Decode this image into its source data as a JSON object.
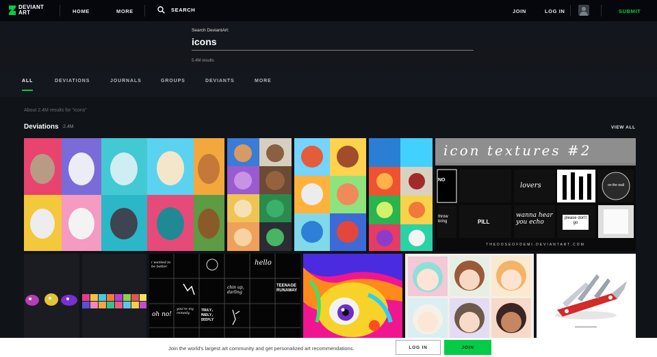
{
  "nav": {
    "logo_line1": "DEVIANT",
    "logo_line2": "ART",
    "home": "HOME",
    "more": "MORE",
    "search": "SEARCH",
    "join": "JOIN",
    "login": "LOG IN",
    "submit": "SUBMIT"
  },
  "search": {
    "label": "Search DeviantArt:",
    "query": "icons",
    "results": "5.4M results"
  },
  "tabs": [
    {
      "label": "ALL",
      "active": true
    },
    {
      "label": "DEVIATIONS"
    },
    {
      "label": "JOURNALS"
    },
    {
      "label": "GROUPS"
    },
    {
      "label": "DEVIANTS"
    },
    {
      "label": "MORE"
    }
  ],
  "content": {
    "about": "About 2.4M results for \"icons\"",
    "section_title": "Deviations",
    "section_count": "2.4M",
    "view_all": "VIEW ALL"
  },
  "thumbnails": {
    "textures_title": "icon textures #2",
    "textures_footer": "THEDOSEOFDEMI.DEVIANTART.COM",
    "texture_pack_words": [
      "i wanted to be better",
      "hello",
      "chin up, darling",
      "TEENAGE RUNAWAY",
      "TRULY, MADLY, DEEPLY",
      "oh no!",
      "you're my remedy"
    ],
    "textures2_words": [
      "NO",
      "lovers",
      "on the wall",
      "throw bring",
      "PILL",
      "wanna hear you echo",
      "please don't go"
    ]
  },
  "banner": {
    "text": "Join the world's largest art community and get personalized art recommendations.",
    "login": "LOG IN",
    "join": "JOIN"
  },
  "colors": {
    "accent": "#05cc47",
    "background": "#06070d",
    "content_bg": "#101318"
  }
}
